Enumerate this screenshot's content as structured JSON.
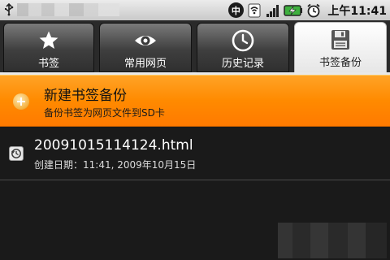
{
  "status_bar": {
    "time": "上午11:41",
    "china_mobile_glyph": "中",
    "icons": [
      "usb-icon",
      "signal-icon",
      "battery-charging-icon",
      "alarm-icon"
    ]
  },
  "tabs": [
    {
      "label": "书签",
      "icon": "star-icon"
    },
    {
      "label": "常用网页",
      "icon": "eye-icon"
    },
    {
      "label": "历史记录",
      "icon": "clock-icon"
    },
    {
      "label": "书签备份",
      "icon": "floppy-disk-icon",
      "active": true
    }
  ],
  "new_backup": {
    "title": "新建书签备份",
    "subtitle": "备份书签为网页文件到SD卡",
    "icon": "add-circle-icon"
  },
  "backup_files": [
    {
      "name": "20091015114124.html",
      "date": "创建日期：11:41, 2009年10月15日",
      "icon": "backup-file-icon"
    }
  ],
  "colors": {
    "highlight": "#ff8a00",
    "background": "#1a1a1a",
    "active_tab": "#ffffff"
  }
}
